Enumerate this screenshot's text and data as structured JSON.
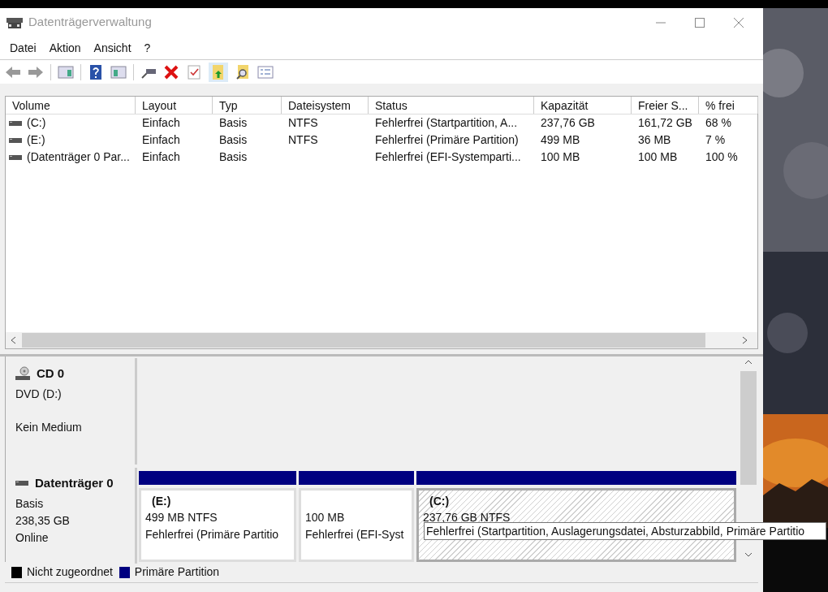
{
  "window": {
    "title": "Datenträgerverwaltung"
  },
  "menu": [
    "Datei",
    "Aktion",
    "Ansicht",
    "?"
  ],
  "volumes": {
    "columns": [
      "Volume",
      "Layout",
      "Typ",
      "Dateisystem",
      "Status",
      "Kapazität",
      "Freier S...",
      "% frei"
    ],
    "rows": [
      [
        "(C:)",
        "Einfach",
        "Basis",
        "NTFS",
        "Fehlerfrei (Startpartition, A...",
        "237,76 GB",
        "161,72 GB",
        "68 %"
      ],
      [
        "(E:)",
        "Einfach",
        "Basis",
        "NTFS",
        "Fehlerfrei (Primäre Partition)",
        "499 MB",
        "36 MB",
        "7 %"
      ],
      [
        "(Datenträger 0 Par...",
        "Einfach",
        "Basis",
        "",
        "Fehlerfrei (EFI-Systemparti...",
        "100 MB",
        "100 MB",
        "100 %"
      ]
    ]
  },
  "disks": [
    {
      "kind": "cd",
      "name": "CD 0",
      "type": "DVD (D:)",
      "status": "Kein Medium"
    },
    {
      "kind": "disk",
      "name": "Datenträger 0",
      "type": "Basis",
      "size": "238,35 GB",
      "status": "Online",
      "partitions": [
        {
          "name": "(E:)",
          "size": "499 MB NTFS",
          "status": "Fehlerfrei (Primäre Partitio",
          "selected": false
        },
        {
          "size": "100 MB",
          "status": "Fehlerfrei (EFI-Syst",
          "selected": false
        },
        {
          "name": "(C:)",
          "size": "237,76 GB NTFS",
          "selected": true
        }
      ]
    }
  ],
  "tooltip": "Fehlerfrei (Startpartition, Auslagerungsdatei, Absturzabbild, Primäre Partitio",
  "legend": [
    {
      "label": "Nicht zugeordnet",
      "color": "#000000"
    },
    {
      "label": "Primäre Partition",
      "color": "#000080"
    }
  ]
}
